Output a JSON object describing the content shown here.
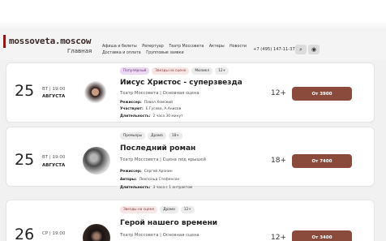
{
  "header": {
    "logo": "mossoveta.moscow",
    "home_label": "Главная",
    "nav_row1": [
      "Афиша и билеты",
      "Репертуар",
      "Театр Моссовета",
      "Актеры",
      "Новости"
    ],
    "nav_row2": [
      "Доставка и оплата",
      "Групповые заявки"
    ],
    "phone": "+7 (495) 147-11-37",
    "search_icon": "search-icon",
    "accessibility_icon": "eye-icon"
  },
  "events": [
    {
      "day": "25",
      "weekday_time": "ВТ | 19:00",
      "month": "АВГУСТА",
      "tags": [
        "Популярный",
        "Звезды на сцене",
        "Мюзикл",
        "12+"
      ],
      "title": "Иисус Христос - суперзвезда",
      "venue": "Театр Моссовета | Основная сцена",
      "director_label": "Режиссер:",
      "director": "Павел Хомский",
      "cast_label": "Участвуют:",
      "cast": "Е.Гусева, А.Анисов",
      "duration_label": "Длительность:",
      "duration": "2 часа 30 минут",
      "age": "12+",
      "price": "От 3900"
    },
    {
      "day": "25",
      "weekday_time": "ВТ | 19:00",
      "month": "АВГУСТА",
      "tags": [
        "Премьеры",
        "Драма",
        "18+"
      ],
      "title": "Последний роман",
      "venue": "Театр Моссовета | Сцена под крышей",
      "director_label": "Режиссер:",
      "director": "Сергей Аронин",
      "cast_label": "Авторы:",
      "cast": "Леопольд Стефенсон",
      "duration_label": "Длительность:",
      "duration": "3 часа с 1 антрактом",
      "age": "18+",
      "price": "От 7400"
    },
    {
      "day": "26",
      "weekday_time": "СР | 19:00",
      "month": "",
      "tags": [
        "Звезды на сцене",
        "Драма",
        "12+"
      ],
      "title": "Герой нашего времени",
      "venue": "Театр Моссовета | Основная сцена",
      "age": "12+",
      "price": "От 3400"
    }
  ]
}
